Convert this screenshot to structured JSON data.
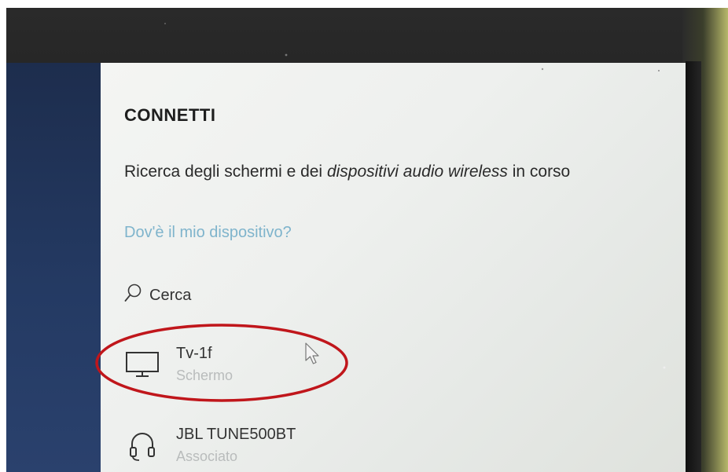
{
  "connect_panel": {
    "title": "CONNETTI",
    "status_plain_1": "Ricerca degli schermi e dei ",
    "status_italic": "dispositivi audio wireless",
    "status_plain_2": " in corso",
    "help_link": "Dov'è il mio dispositivo?",
    "search": {
      "label": "Cerca",
      "icon": "search-icon"
    },
    "devices": [
      {
        "name": "Tv-1f",
        "subtitle": "Schermo",
        "icon": "monitor-icon"
      },
      {
        "name": "JBL TUNE500BT",
        "subtitle": "Associato",
        "icon": "headphones-icon"
      }
    ]
  },
  "colors": {
    "panel_bg": "#eef0ee",
    "link": "#7fb4cc",
    "subtitle": "#b9bcbc",
    "highlight_ring": "#c0161b",
    "desktop_blue": "#243a63",
    "bezel": "#222222"
  }
}
